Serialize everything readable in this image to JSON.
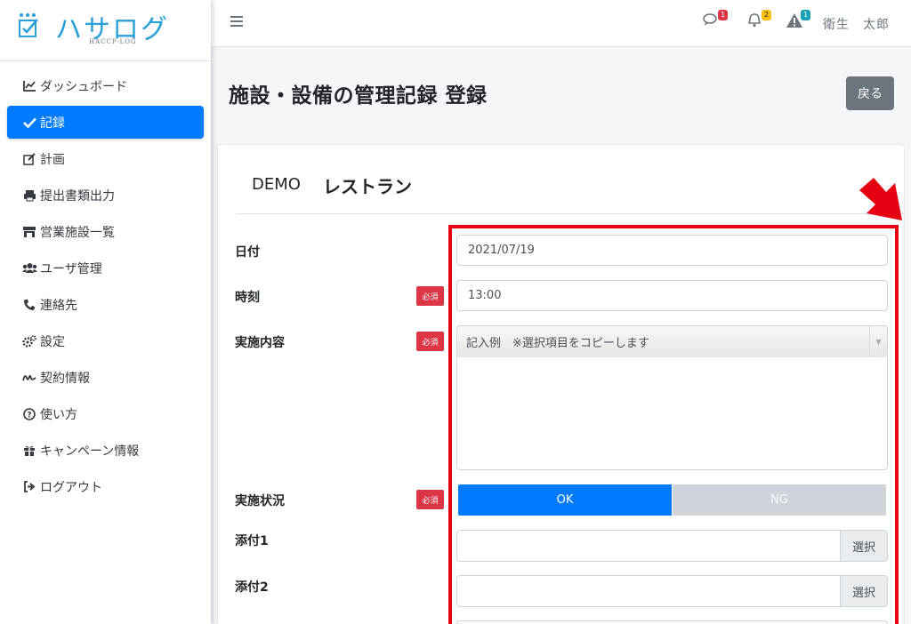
{
  "brand": {
    "name": "ハサログ",
    "sub": "HACCP-LOG"
  },
  "sidebar": {
    "items": [
      {
        "label": "ダッシュボード",
        "icon": "chart-line-icon"
      },
      {
        "label": "記録",
        "icon": "check-icon",
        "active": true
      },
      {
        "label": "計画",
        "icon": "edit-icon"
      },
      {
        "label": "提出書類出力",
        "icon": "print-icon"
      },
      {
        "label": "営業施設一覧",
        "icon": "store-icon"
      },
      {
        "label": "ユーザ管理",
        "icon": "users-icon"
      },
      {
        "label": "連絡先",
        "icon": "phone-icon"
      },
      {
        "label": "設定",
        "icon": "gears-icon"
      },
      {
        "label": "契約情報",
        "icon": "signature-icon"
      },
      {
        "label": "使い方",
        "icon": "question-circle-icon"
      },
      {
        "label": "キャンペーン情報",
        "icon": "gift-icon"
      },
      {
        "label": "ログアウト",
        "icon": "sign-out-icon"
      }
    ]
  },
  "topbar": {
    "messages_badge": "1",
    "notifications_badge": "2",
    "alerts_badge": "1",
    "user_name": "衛生　太郎",
    "colors": {
      "messages": "#dc3545",
      "notifications": "#ffc107",
      "alerts": "#17a2b8"
    }
  },
  "page": {
    "title": "施設・設備の管理記録 登録",
    "back_label": "戻る"
  },
  "facility": {
    "code": "DEMO",
    "name": "レストラン"
  },
  "form": {
    "date": {
      "label": "日付",
      "value": "2021/07/19"
    },
    "time": {
      "label": "時刻",
      "required": "必須",
      "value": "13:00"
    },
    "content": {
      "label": "実施内容",
      "required": "必須",
      "select_text": "記入例　※選択項目をコピーします"
    },
    "status": {
      "label": "実施状況",
      "required": "必須",
      "ok_label": "OK",
      "ng_label": "NG",
      "selected": "OK"
    },
    "attach1": {
      "label": "添付1",
      "button": "選択"
    },
    "attach2": {
      "label": "添付2",
      "button": "選択"
    }
  },
  "colors": {
    "accent": "#007bff",
    "annotation": "#e60012",
    "required": "#dc3545"
  }
}
